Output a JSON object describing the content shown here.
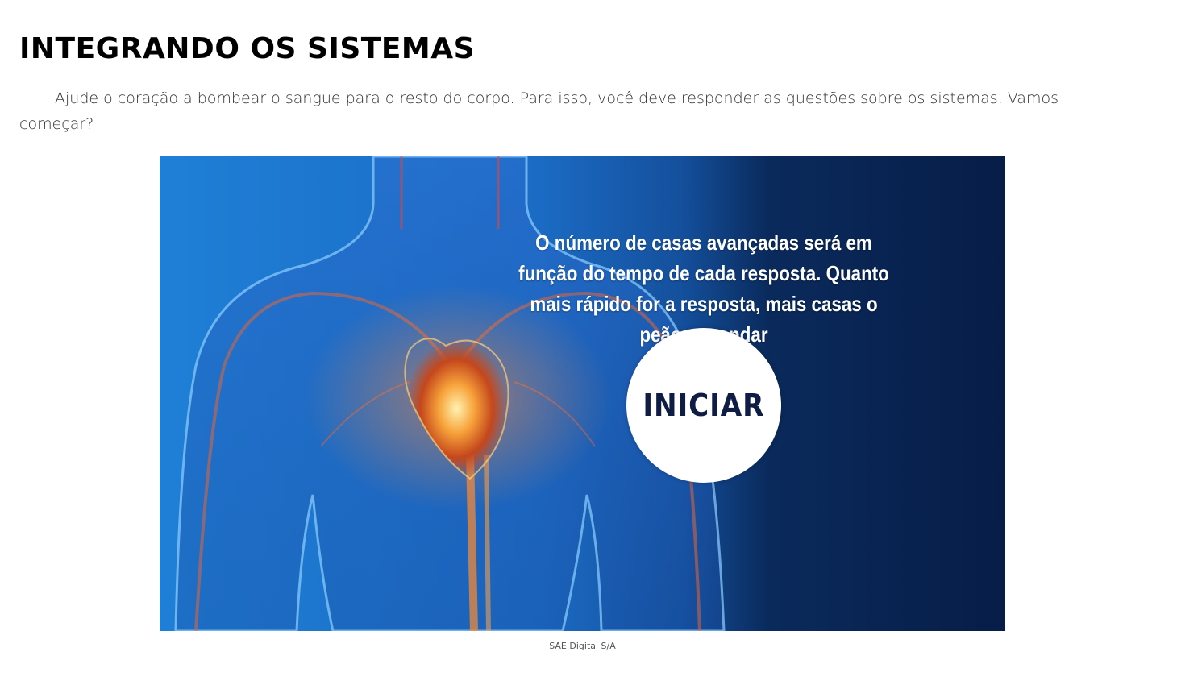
{
  "page": {
    "title": "INTEGRANDO OS SISTEMAS",
    "intro": "Ajude o coração a bombear o sangue para o resto do corpo. Para isso, você deve responder as questões sobre os sistemas. Vamos começar?"
  },
  "game": {
    "info_text": "O número de casas avançadas será em função do tempo de cada resposta. Quanto mais rápido for a resposta, mais casas o peão var andar",
    "start_label": "INICIAR",
    "background_color_light": "#1f7fd6",
    "background_color_dark": "#071d47",
    "illustration": "human-torso-heart-illustration"
  },
  "caption": "SAE Digital S/A"
}
